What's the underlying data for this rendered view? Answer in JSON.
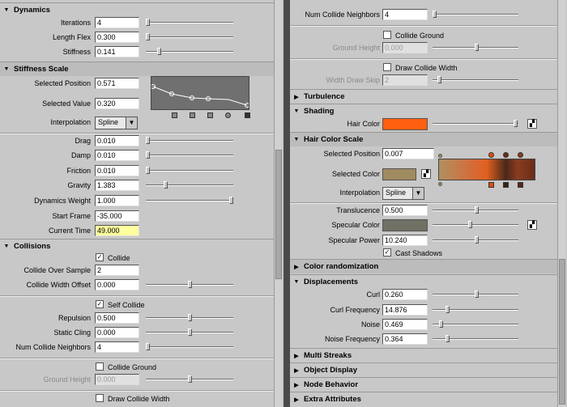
{
  "left": {
    "dynamics": {
      "title": "Dynamics",
      "iterations_label": "Iterations",
      "iterations": "4",
      "length_flex_label": "Length Flex",
      "length_flex": "0.300",
      "stiffness_label": "Stiffness",
      "stiffness": "0.141"
    },
    "stiffness_scale": {
      "title": "Stiffness Scale",
      "selected_position_label": "Selected Position",
      "selected_position": "0.571",
      "selected_value_label": "Selected Value",
      "selected_value": "0.320",
      "interpolation_label": "Interpolation",
      "interpolation": "Spline"
    },
    "params": {
      "drag_label": "Drag",
      "drag": "0.010",
      "damp_label": "Damp",
      "damp": "0.010",
      "friction_label": "Friction",
      "friction": "0.010",
      "gravity_label": "Gravity",
      "gravity": "1.383",
      "dyn_weight_label": "Dynamics Weight",
      "dyn_weight": "1.000",
      "start_frame_label": "Start Frame",
      "start_frame": "-35.000",
      "current_time_label": "Current Time",
      "current_time": "49.000"
    },
    "collisions": {
      "title": "Collisions",
      "collide_label": "Collide",
      "oversample_label": "Collide Over Sample",
      "oversample": "2",
      "width_offset_label": "Collide Width Offset",
      "width_offset": "0.000",
      "self_collide_label": "Self Collide",
      "repulsion_label": "Repulsion",
      "repulsion": "0.500",
      "static_cling_label": "Static Cling",
      "static_cling": "0.000",
      "num_neighbors_label": "Num Collide Neighbors",
      "num_neighbors": "4",
      "collide_ground_label": "Collide Ground",
      "ground_height_label": "Ground Height",
      "ground_height": "0.000",
      "draw_width_label": "Draw Collide Width"
    }
  },
  "right": {
    "num_neighbors_label": "Num Collide Neighbors",
    "num_neighbors": "4",
    "collide_ground_label": "Collide Ground",
    "ground_height_label": "Ground Height",
    "ground_height": "0.000",
    "draw_width_label": "Draw Collide Width",
    "draw_step_label": "Width Draw Skip",
    "draw_step": "2",
    "turbulence": "Turbulence",
    "shading": "Shading",
    "hair_color_label": "Hair Color",
    "hair_color": "#ff6010",
    "hair_color_scale": "Hair Color Scale",
    "sel_pos_label": "Selected Position",
    "sel_pos": "0.007",
    "sel_color_label": "Selected Color",
    "sel_color": "#a08a60",
    "interp_label": "Interpolation",
    "interp": "Spline",
    "translucence_label": "Translucence",
    "translucence": "0.500",
    "specular_color_label": "Specular Color",
    "specular_color": "#707064",
    "specular_power_label": "Specular Power",
    "specular_power": "10.240",
    "cast_shadows_label": "Cast Shadows",
    "color_randomization": "Color randomization",
    "displacements": "Displacements",
    "curl_label": "Curl",
    "curl": "0.260",
    "curl_freq_label": "Curl Frequency",
    "curl_freq": "14.876",
    "noise_label": "Noise",
    "noise": "0.469",
    "noise_freq_label": "Noise Frequency",
    "noise_freq": "0.364",
    "multi_streaks": "Multi Streaks",
    "object_display": "Object Display",
    "node_behavior": "Node Behavior",
    "extra_attributes": "Extra Attributes"
  }
}
